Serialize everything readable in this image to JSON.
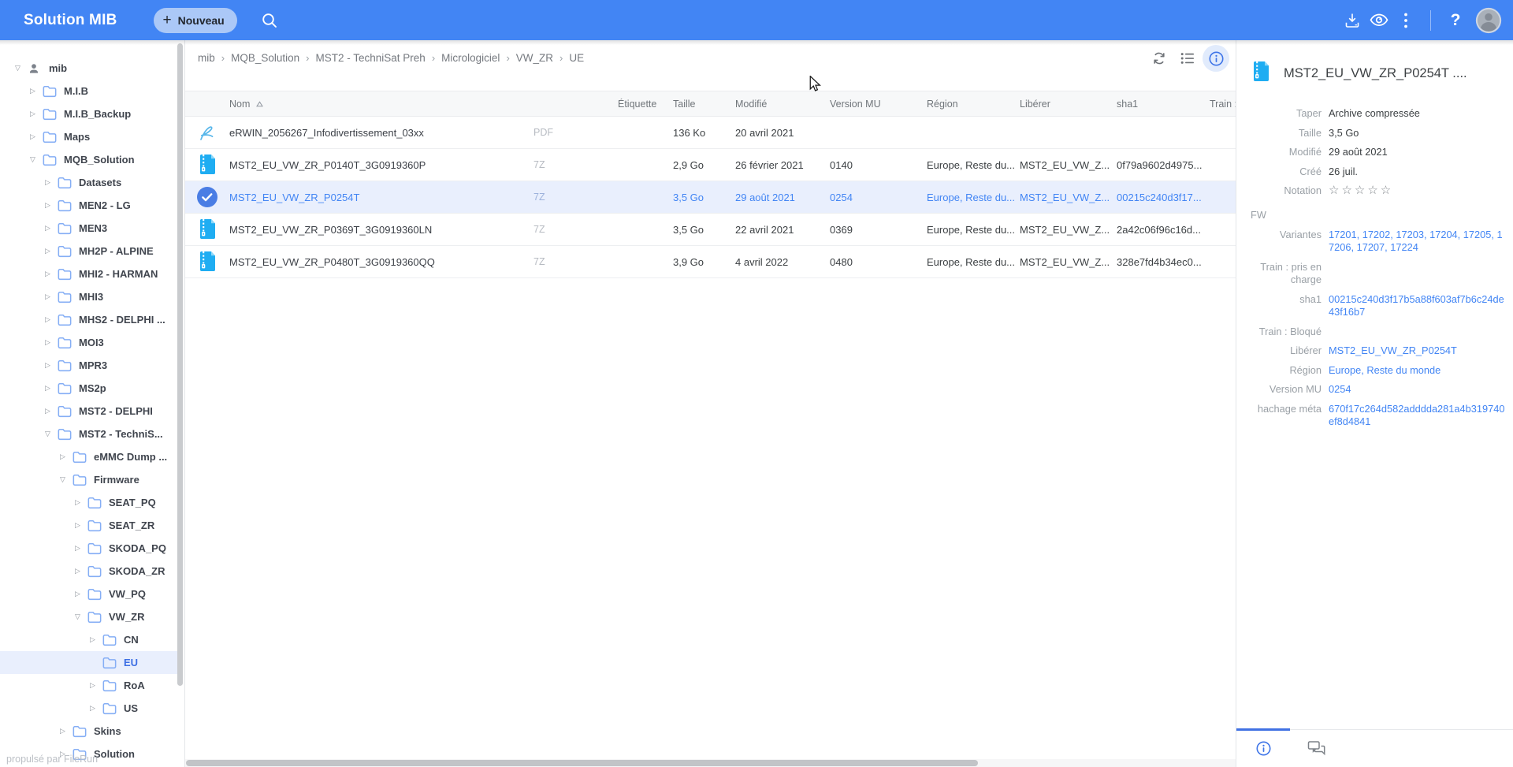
{
  "app": {
    "title": "Solution MIB",
    "new_button_label": "Nouveau",
    "powered_by": "propulsé par FileRun"
  },
  "header": {
    "icons": [
      "search-icon",
      "download-icon",
      "preview-eye-icon",
      "more-options-icon",
      "help-icon",
      "user-avatar"
    ]
  },
  "sidebar": {
    "items": [
      {
        "label": "mib",
        "level": 0,
        "arrow": "expanded",
        "icon": "user",
        "selected": false
      },
      {
        "label": "M.I.B",
        "level": 1,
        "arrow": "collapsed",
        "icon": "folder",
        "selected": false
      },
      {
        "label": "M.I.B_Backup",
        "level": 1,
        "arrow": "collapsed",
        "icon": "folder",
        "selected": false
      },
      {
        "label": "Maps",
        "level": 1,
        "arrow": "collapsed",
        "icon": "folder",
        "selected": false
      },
      {
        "label": "MQB_Solution",
        "level": 1,
        "arrow": "expanded",
        "icon": "folder",
        "selected": false
      },
      {
        "label": "Datasets",
        "level": 2,
        "arrow": "collapsed",
        "icon": "folder",
        "selected": false
      },
      {
        "label": "MEN2 - LG",
        "level": 2,
        "arrow": "collapsed",
        "icon": "folder",
        "selected": false
      },
      {
        "label": "MEN3",
        "level": 2,
        "arrow": "collapsed",
        "icon": "folder",
        "selected": false
      },
      {
        "label": "MH2P - ALPINE",
        "level": 2,
        "arrow": "collapsed",
        "icon": "folder",
        "selected": false
      },
      {
        "label": "MHI2 - HARMAN",
        "level": 2,
        "arrow": "collapsed",
        "icon": "folder",
        "selected": false
      },
      {
        "label": "MHI3",
        "level": 2,
        "arrow": "collapsed",
        "icon": "folder",
        "selected": false
      },
      {
        "label": "MHS2 - DELPHI ...",
        "level": 2,
        "arrow": "collapsed",
        "icon": "folder",
        "selected": false
      },
      {
        "label": "MOI3",
        "level": 2,
        "arrow": "collapsed",
        "icon": "folder",
        "selected": false
      },
      {
        "label": "MPR3",
        "level": 2,
        "arrow": "collapsed",
        "icon": "folder",
        "selected": false
      },
      {
        "label": "MS2p",
        "level": 2,
        "arrow": "collapsed",
        "icon": "folder",
        "selected": false
      },
      {
        "label": "MST2 - DELPHI",
        "level": 2,
        "arrow": "collapsed",
        "icon": "folder",
        "selected": false
      },
      {
        "label": "MST2 - TechniS...",
        "level": 2,
        "arrow": "expanded",
        "icon": "folder",
        "selected": false
      },
      {
        "label": "eMMC Dump ...",
        "level": 3,
        "arrow": "collapsed",
        "icon": "folder",
        "selected": false
      },
      {
        "label": "Firmware",
        "level": 3,
        "arrow": "expanded",
        "icon": "folder",
        "selected": false
      },
      {
        "label": "SEAT_PQ",
        "level": 4,
        "arrow": "collapsed",
        "icon": "folder",
        "selected": false
      },
      {
        "label": "SEAT_ZR",
        "level": 4,
        "arrow": "collapsed",
        "icon": "folder",
        "selected": false
      },
      {
        "label": "SKODA_PQ",
        "level": 4,
        "arrow": "collapsed",
        "icon": "folder",
        "selected": false
      },
      {
        "label": "SKODA_ZR",
        "level": 4,
        "arrow": "collapsed",
        "icon": "folder",
        "selected": false
      },
      {
        "label": "VW_PQ",
        "level": 4,
        "arrow": "collapsed",
        "icon": "folder",
        "selected": false
      },
      {
        "label": "VW_ZR",
        "level": 4,
        "arrow": "expanded",
        "icon": "folder",
        "selected": false
      },
      {
        "label": "CN",
        "level": 5,
        "arrow": "collapsed",
        "icon": "folder",
        "selected": false
      },
      {
        "label": "EU",
        "level": 5,
        "arrow": "none",
        "icon": "folder",
        "selected": true
      },
      {
        "label": "RoA",
        "level": 5,
        "arrow": "collapsed",
        "icon": "folder",
        "selected": false
      },
      {
        "label": "US",
        "level": 5,
        "arrow": "collapsed",
        "icon": "folder",
        "selected": false
      },
      {
        "label": "Skins",
        "level": 3,
        "arrow": "collapsed",
        "icon": "folder",
        "selected": false
      },
      {
        "label": "Solution",
        "level": 3,
        "arrow": "collapsed",
        "icon": "folder",
        "selected": false
      }
    ]
  },
  "breadcrumb": {
    "segments": [
      "mib",
      "MQB_Solution",
      "MST2 - TechniSat Preh",
      "Micrologiciel",
      "VW_ZR",
      "UE"
    ],
    "separator": "›"
  },
  "toolbar": {
    "icons": [
      "refresh-icon",
      "list-view-icon",
      "info-icon"
    ],
    "active": "info-icon"
  },
  "table": {
    "headers": {
      "name": "Nom",
      "tag": "Étiquette",
      "size": "Taille",
      "modified": "Modifié",
      "version_mu": "Version MU",
      "region": "Région",
      "release": "Libérer",
      "sha1": "sha1",
      "train": "Train :"
    },
    "sort": {
      "column": "name",
      "direction": "asc"
    },
    "rows": [
      {
        "icon": "pdf",
        "name": "eRWIN_2056267_Infodivertissement_03xx",
        "type": "PDF",
        "tag": "",
        "size": "136 Ko",
        "modified": "20 avril 2021",
        "version_mu": "",
        "region": "",
        "release": "",
        "sha1": "",
        "selected": false
      },
      {
        "icon": "zip",
        "name": "MST2_EU_VW_ZR_P0140T_3G0919360P",
        "type": "7Z",
        "tag": "",
        "size": "2,9 Go",
        "modified": "26 février 2021",
        "version_mu": "0140",
        "region": "Europe, Reste du...",
        "release": "MST2_EU_VW_Z...",
        "sha1": "0f79a9602d4975...",
        "selected": false
      },
      {
        "icon": "check",
        "name": "MST2_EU_VW_ZR_P0254T",
        "type": "7Z",
        "tag": "",
        "size": "3,5 Go",
        "modified": "29 août 2021",
        "version_mu": "0254",
        "region": "Europe, Reste du...",
        "release": "MST2_EU_VW_Z...",
        "sha1": "00215c240d3f17...",
        "selected": true
      },
      {
        "icon": "zip",
        "name": "MST2_EU_VW_ZR_P0369T_3G0919360LN",
        "type": "7Z",
        "tag": "",
        "size": "3,5 Go",
        "modified": "22 avril 2021",
        "version_mu": "0369",
        "region": "Europe, Reste du...",
        "release": "MST2_EU_VW_Z...",
        "sha1": "2a42c06f96c16d...",
        "selected": false
      },
      {
        "icon": "zip",
        "name": "MST2_EU_VW_ZR_P0480T_3G0919360QQ",
        "type": "7Z",
        "tag": "",
        "size": "3,9 Go",
        "modified": "4 avril 2022",
        "version_mu": "0480",
        "region": "Europe, Reste du...",
        "release": "MST2_EU_VW_Z...",
        "sha1": "328e7fd4b34ec0...",
        "selected": false
      }
    ]
  },
  "details": {
    "title": "MST2_EU_VW_ZR_P0254T ....",
    "sections": [
      {
        "header": "",
        "rows": [
          {
            "label": "Taper",
            "value": "Archive compressée",
            "type": "text"
          },
          {
            "label": "Taille",
            "value": "3,5 Go",
            "type": "text"
          },
          {
            "label": "Modifié",
            "value": "29 août 2021",
            "type": "text"
          },
          {
            "label": "Créé",
            "value": "26 juil.",
            "type": "text"
          },
          {
            "label": "Notation",
            "value": "☆☆☆☆☆",
            "type": "stars"
          }
        ]
      },
      {
        "header": "FW",
        "rows": [
          {
            "label": "Variantes",
            "value": "17201, 17202, 17203, 17204, 17205, 17206, 17207, 17224",
            "type": "link"
          },
          {
            "label": "Train : pris en charge",
            "value": "",
            "type": "text"
          },
          {
            "label": "sha1",
            "value": "00215c240d3f17b5a88f603af7b6c24de43f16b7",
            "type": "link"
          },
          {
            "label": "Train : Bloqué",
            "value": "",
            "type": "text"
          },
          {
            "label": "Libérer",
            "value": "MST2_EU_VW_ZR_P0254T",
            "type": "link"
          },
          {
            "label": "Région",
            "value": "Europe, Reste du monde",
            "type": "link"
          },
          {
            "label": "Version MU",
            "value": "0254",
            "type": "link"
          },
          {
            "label": "hachage méta",
            "value": "670f17c264d582adddda281a4b319740ef8d4841",
            "type": "link"
          }
        ]
      }
    ],
    "tabs": [
      "info-icon",
      "comments-icon"
    ]
  },
  "colors": {
    "header": "#4285f4",
    "accent": "#4285f4",
    "selected_row_bg": "#e9effd",
    "zip_icon": "#1fadf2",
    "link": "#4285f4"
  }
}
